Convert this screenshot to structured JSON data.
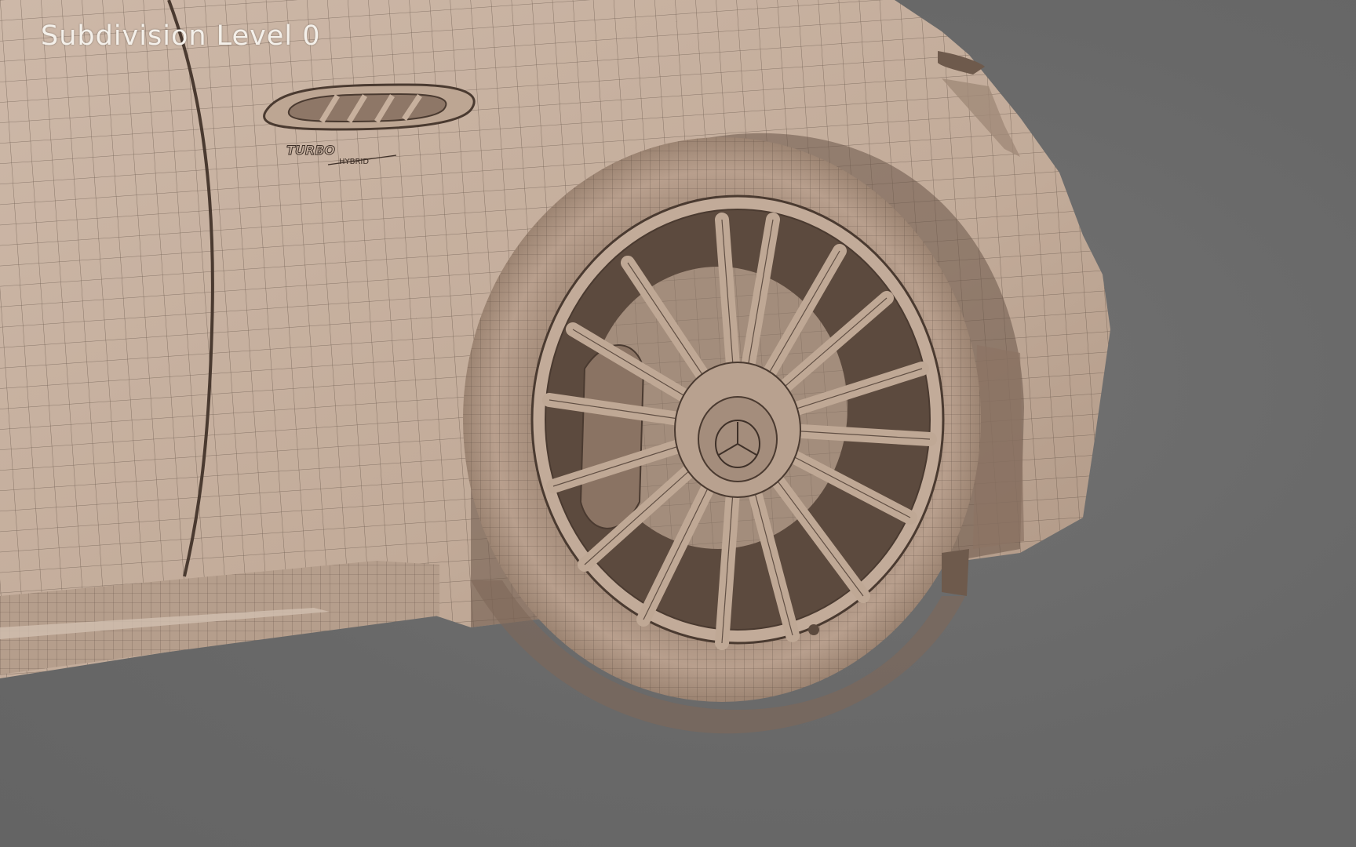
{
  "viewport": {
    "overlay_label": "Subdivision Level 0",
    "background_color": "#6b6b6b",
    "model_clay_color": "#c9b3a2",
    "wire_color": "#4a3a30"
  },
  "model": {
    "badge_text_top": "TURBO",
    "badge_text_bottom": "HYBRID"
  }
}
